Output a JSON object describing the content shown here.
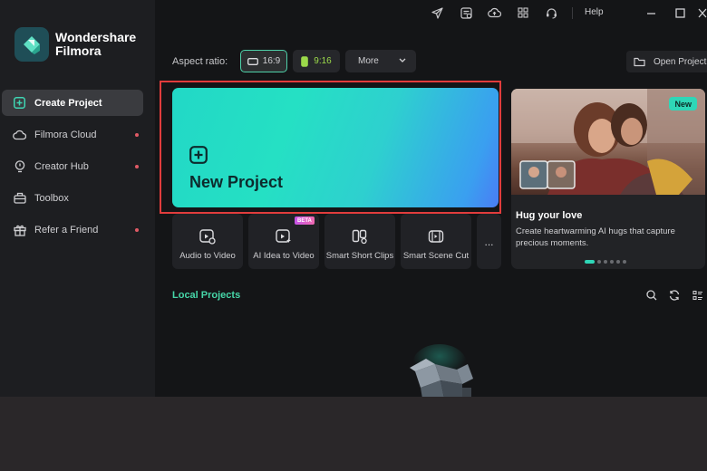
{
  "app": {
    "brand_line1": "Wondershare",
    "brand_line2": "Filmora"
  },
  "titlebar": {
    "help_label": "Help"
  },
  "sidebar": {
    "items": [
      {
        "label": "Create Project",
        "active": true,
        "dot": false
      },
      {
        "label": "Filmora Cloud",
        "dot": true
      },
      {
        "label": "Creator Hub",
        "dot": true
      },
      {
        "label": "Toolbox",
        "dot": false
      },
      {
        "label": "Refer a Friend",
        "dot": true
      }
    ]
  },
  "aspect": {
    "label": "Aspect ratio:",
    "options": [
      "16:9",
      "9:16"
    ],
    "selected": "16:9",
    "more_label": "More"
  },
  "open_project_label": "Open Project",
  "new_project": {
    "label": "New Project"
  },
  "tools": [
    {
      "label": "Audio to Video"
    },
    {
      "label": "AI Idea to Video",
      "badge": "BETA"
    },
    {
      "label": "Smart Short Clips"
    },
    {
      "label": "Smart Scene Cut"
    }
  ],
  "more_tools_label": "...",
  "promo": {
    "badge": "New",
    "title": "Hug your love",
    "description": "Create heartwarming AI hugs that capture precious moments.",
    "slide_count": 6,
    "active_slide": 1
  },
  "local_projects": {
    "title": "Local Projects"
  },
  "colors": {
    "accent": "#2fd6b7",
    "highlight_frame": "#e13c3c",
    "notify_dot": "#e05a65"
  }
}
